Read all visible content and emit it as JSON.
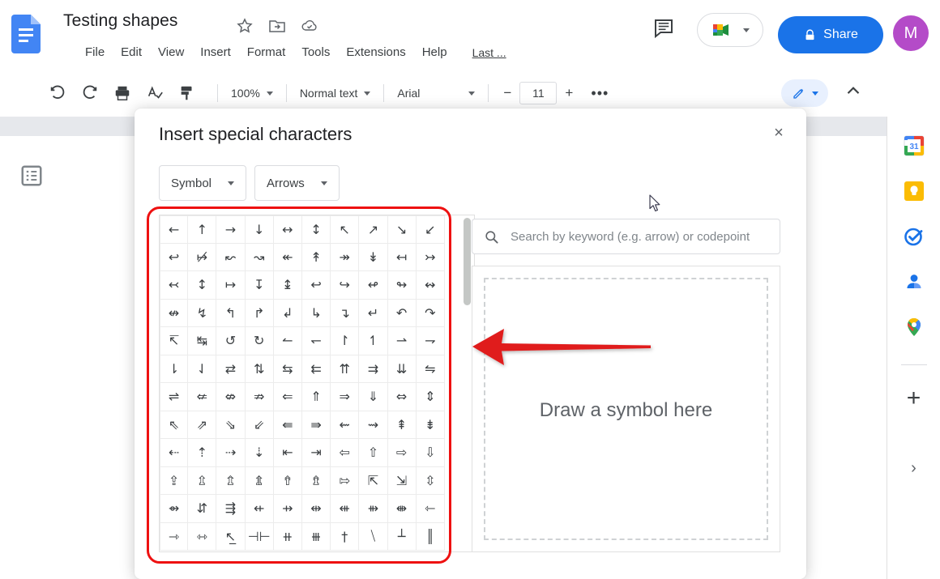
{
  "app": {
    "doc_title": "Testing shapes",
    "menus": [
      "File",
      "Edit",
      "View",
      "Insert",
      "Format",
      "Tools",
      "Extensions",
      "Help"
    ],
    "last_edit": "Last ...",
    "share_label": "Share",
    "avatar_initial": "M",
    "icons": {
      "docs_logo": "google-docs-logo",
      "star": "star-icon",
      "move_folder": "move-to-folder-icon",
      "cloud": "cloud-saved-icon",
      "comment": "comment-history-icon",
      "meet": "google-meet-icon",
      "lock": "lock-icon"
    }
  },
  "toolbar": {
    "zoom": "100%",
    "paragraph_style": "Normal text",
    "font": "Arial",
    "font_size": "11",
    "more_label": "•••",
    "minus_label": "−",
    "plus_label": "+",
    "icons": [
      "undo-icon",
      "redo-icon",
      "print-icon",
      "spelling-check-icon",
      "paint-format-icon",
      "edit-mode-icon",
      "collapse-toolbar-icon"
    ]
  },
  "side_panel": {
    "items": [
      {
        "name": "google-calendar-icon",
        "label": "Calendar"
      },
      {
        "name": "google-keep-icon",
        "label": "Keep"
      },
      {
        "name": "google-tasks-icon",
        "label": "Tasks"
      },
      {
        "name": "google-contacts-icon",
        "label": "Contacts"
      },
      {
        "name": "google-maps-icon",
        "label": "Maps"
      }
    ],
    "add_label": "+",
    "expand_label": "›"
  },
  "dialog": {
    "title": "Insert special characters",
    "close_label": "×",
    "category_select": "Symbol",
    "subcategory_select": "Arrows",
    "search_placeholder": "Search by keyword (e.g. arrow) or codepoint",
    "search_value": "",
    "draw_hint": "Draw a symbol here",
    "grid_rows": [
      [
        "←",
        "↑",
        "→",
        "↓",
        "↔",
        "↕",
        "↖",
        "↗",
        "↘",
        "↙"
      ],
      [
        "↩",
        "↦̸",
        "↜",
        "↝",
        "↞",
        "↟",
        "↠",
        "↡",
        "↤",
        "↣"
      ],
      [
        "↢",
        "↕",
        "↦",
        "↧",
        "↨",
        "↩",
        "↪",
        "↫",
        "↬",
        "↭"
      ],
      [
        "↮",
        "↯",
        "↰",
        "↱",
        "↲",
        "↳",
        "↴",
        "↵",
        "↶",
        "↷"
      ],
      [
        "↸",
        "↹",
        "↺",
        "↻",
        "↼",
        "↽",
        "↾",
        "↿",
        "⇀",
        "⇁"
      ],
      [
        "⇂",
        "⇃",
        "⇄",
        "⇅",
        "⇆",
        "⇇",
        "⇈",
        "⇉",
        "⇊",
        "⇋"
      ],
      [
        "⇌",
        "⇍",
        "⇎",
        "⇏",
        "⇐",
        "⇑",
        "⇒",
        "⇓",
        "⇔",
        "⇕"
      ],
      [
        "⇖",
        "⇗",
        "⇘",
        "⇙",
        "⇚",
        "⇛",
        "⇜",
        "⇝",
        "⇞",
        "⇟"
      ],
      [
        "⇠",
        "⇡",
        "⇢",
        "⇣",
        "⇤",
        "⇥",
        "⇦",
        "⇧",
        "⇨",
        "⇩"
      ],
      [
        "⇪",
        "⇫",
        "⇬",
        "⇭",
        "⇮",
        "⇯",
        "⇰",
        "⇱",
        "⇲",
        "⇳"
      ],
      [
        "⇴",
        "⇵",
        "⇶",
        "⇷",
        "⇸",
        "⇹",
        "⇺",
        "⇻",
        "⇼",
        "⇽"
      ],
      [
        "⇾",
        "⇿",
        "↖̲",
        "⊣⊢",
        "⧺",
        "⧻",
        "†",
        "⧹",
        "┴",
        "║"
      ]
    ]
  },
  "annotations": {
    "highlight_color": "#ee1111",
    "arrow_color": "#e01b1b",
    "arrow_direction": "left"
  }
}
